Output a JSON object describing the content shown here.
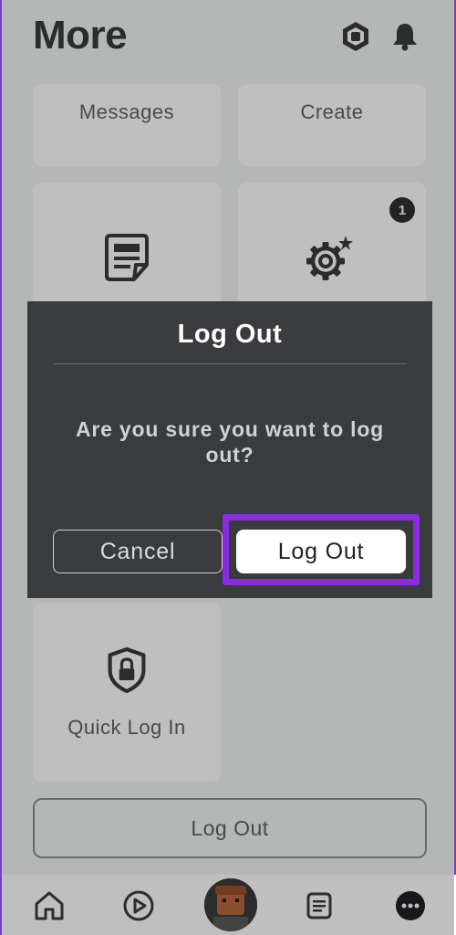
{
  "header": {
    "title": "More",
    "icons": [
      "robux-icon",
      "bell-icon"
    ]
  },
  "tiles": {
    "messages": {
      "label": "Messages"
    },
    "create": {
      "label": "Create"
    },
    "blog": {
      "icon": "document-icon"
    },
    "settings": {
      "icon": "gear-icon",
      "badge": "1"
    },
    "quick_login": {
      "label": "Quick Log In",
      "icon": "shield-lock-icon"
    }
  },
  "bottom_button": {
    "label": "Log Out"
  },
  "nav": {
    "items": [
      "home-icon",
      "play-icon",
      "avatar",
      "list-icon",
      "more-icon"
    ]
  },
  "dialog": {
    "title": "Log Out",
    "message": "Are you sure you want to log out?",
    "cancel_label": "Cancel",
    "confirm_label": "Log Out"
  },
  "colors": {
    "highlight": "#8a2be2",
    "dialog_bg": "#393b3d",
    "page_bg": "#f2f4f5"
  }
}
